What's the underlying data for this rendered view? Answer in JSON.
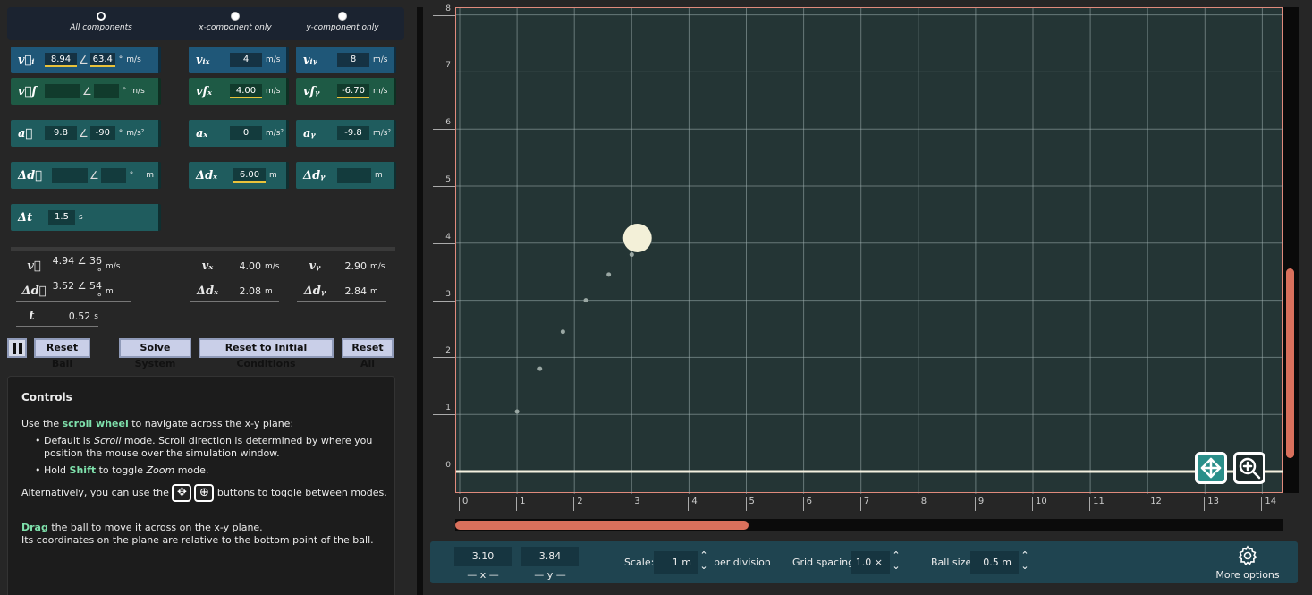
{
  "mode": {
    "options": [
      "All components",
      "x-component only",
      "y-component only"
    ],
    "selected": "All components"
  },
  "inputs": {
    "vi": {
      "mag": "8.94",
      "angle": "63.4",
      "deg": "°",
      "unit": "m/s"
    },
    "vix": {
      "value": "4",
      "unit": "m/s"
    },
    "viy": {
      "value": "8",
      "unit": "m/s"
    },
    "vf": {
      "mag": "",
      "angle": "",
      "deg": "°",
      "unit": "m/s"
    },
    "vfx": {
      "value": "4.00",
      "unit": "m/s"
    },
    "vfy": {
      "value": "-6.70",
      "unit": "m/s"
    },
    "a": {
      "mag": "9.8",
      "angle": "-90",
      "deg": "°",
      "unit": "m/s²"
    },
    "ax": {
      "value": "0",
      "unit": "m/s²"
    },
    "ay": {
      "value": "-9.8",
      "unit": "m/s²"
    },
    "dd": {
      "mag": "",
      "angle": "",
      "deg": "°",
      "unit": "m"
    },
    "dx": {
      "value": "6.00",
      "unit": "m"
    },
    "dy": {
      "value": "",
      "unit": "m"
    },
    "dt": {
      "value": "1.5",
      "unit": "s"
    }
  },
  "symbols": {
    "vi": "v⃗ᵢ",
    "vix": "vᵢₓ",
    "viy": "vᵢᵧ",
    "vf": "v⃗f",
    "vfx": "vfₓ",
    "vfy": "vfᵧ",
    "a": "a⃗",
    "ax": "aₓ",
    "ay": "aᵧ",
    "dd": "Δd⃗",
    "dx": "Δdₓ",
    "dy": "Δdᵧ",
    "dt": "Δt",
    "v": "v⃗",
    "vx": "vₓ",
    "vy": "vᵧ",
    "t": "t",
    "angle": "∠"
  },
  "readouts": {
    "v": {
      "value": "4.94 ∠ 36 °",
      "unit": "m/s"
    },
    "vx": {
      "value": "4.00",
      "unit": "m/s"
    },
    "vy": {
      "value": "2.90",
      "unit": "m/s"
    },
    "d": {
      "value": "3.52 ∠ 54 °",
      "unit": "m"
    },
    "dx": {
      "value": "2.08",
      "unit": "m"
    },
    "dy": {
      "value": "2.84",
      "unit": "m"
    },
    "t": {
      "value": "0.52",
      "unit": "s"
    }
  },
  "buttons": {
    "reset_ball": "Reset Ball",
    "solve_system": "Solve System",
    "reset_initial": "Reset to Initial Conditions",
    "reset_all": "Reset All"
  },
  "controls": {
    "title": "Controls",
    "l1_pre": "Use the ",
    "l1_hl": "scroll wheel",
    "l1_post": " to navigate across the x-y plane:",
    "b1_pre": "Default is ",
    "b1_it": "Scroll",
    "b1_post": " mode. Scroll direction is determined by where you",
    "b1_cont": "position the mouse over the simulation window.",
    "b2_pre": "Hold ",
    "b2_hl": "Shift",
    "b2_mid": " to toggle ",
    "b2_it": "Zoom",
    "b2_post": " mode.",
    "alt_pre": "Alternatively, you can use the",
    "alt_post": "buttons to toggle between modes.",
    "drag_hl": "Drag",
    "drag_post": " the ball to move it across on the x-y plane.",
    "drag_cont": "Its coordinates on the plane are relative to the bottom point of the ball."
  },
  "plot": {
    "x_ticks": [
      "0",
      "1",
      "2",
      "3",
      "4",
      "5",
      "6",
      "7",
      "8",
      "9",
      "10",
      "11",
      "12",
      "13",
      "14"
    ],
    "y_ticks": [
      "0",
      "1",
      "2",
      "3",
      "4",
      "5",
      "6",
      "7",
      "8"
    ],
    "ball": {
      "x": 3.1,
      "y": 3.84
    },
    "trail": [
      [
        1.0,
        1.05
      ],
      [
        1.4,
        1.8
      ],
      [
        1.8,
        2.45
      ],
      [
        2.2,
        3.0
      ],
      [
        2.6,
        3.45
      ],
      [
        3.0,
        3.8
      ]
    ],
    "colors": {
      "plot_bg": "#243535",
      "grid": "#9fb0b0",
      "ground": "#f4f1e0",
      "ball": "#f3f0d8",
      "border": "#e08a7c",
      "scroll": "#d9705c"
    }
  },
  "bottom": {
    "x_value": "3.10",
    "x_label": "— x —",
    "y_value": "3.84",
    "y_label": "— y —",
    "scale_label": "Scale:",
    "scale_value": "1 m",
    "scale_suffix": "per division",
    "grid_label": "Grid spacing",
    "grid_value": "1.0 ×",
    "ball_label": "Ball size",
    "ball_value": "0.5 m",
    "more_options": "More options"
  }
}
